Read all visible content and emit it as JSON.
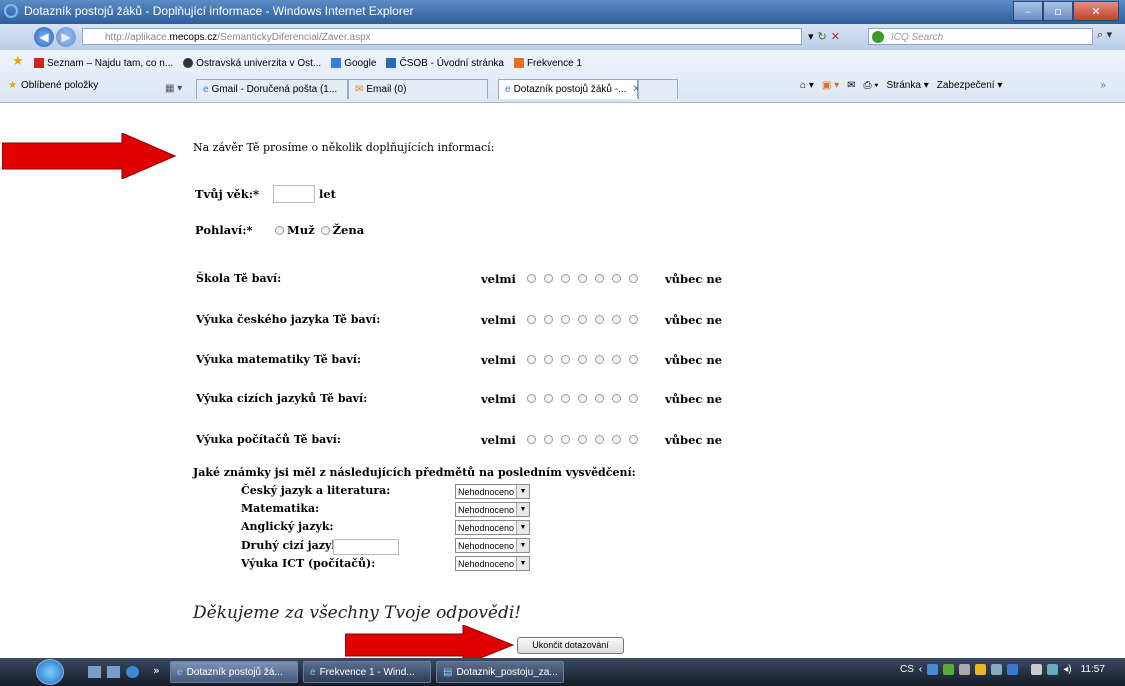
{
  "window": {
    "title": "Dotazník postojů žáků - Doplňující informace - Windows Internet Explorer",
    "minimize": "–",
    "maximize": "▫",
    "close": "✕"
  },
  "address": {
    "url_prefix": "http://aplikace.",
    "url_domain": "mecops.cz",
    "url_path": "/SemantickyDiferencial/Zaver.aspx",
    "search_placeholder": "ICQ Search"
  },
  "favorites": {
    "items": [
      {
        "label": "Seznam – Najdu tam, co n...",
        "icon": "seznam-icon",
        "color": "#d92020"
      },
      {
        "label": "Ostravská univerzita v Ost...",
        "icon": "university-icon",
        "color": "#333333"
      },
      {
        "label": "Google",
        "icon": "google-icon",
        "color": "#3a7be0"
      },
      {
        "label": "ČSOB - Úvodní stránka",
        "icon": "bank-icon",
        "color": "#2b6cb0"
      },
      {
        "label": "Frekvence 1",
        "icon": "radio-icon",
        "color": "#e8701a"
      }
    ],
    "favorites_label": "Oblíbené položky"
  },
  "tabs": [
    {
      "label": "Gmail - Doručená pošta (1..."
    },
    {
      "label": "Email (0)"
    },
    {
      "label": "Dotazník postojů žáků -...",
      "active": true
    }
  ],
  "commands": {
    "page": "Stránka ▾",
    "safety": "Zabezpečení ▾",
    "more": "»"
  },
  "form": {
    "intro": "Na závěr Tě prosíme o několik doplňujících informací:",
    "age_label": "Tvůj věk:*",
    "age_value": "",
    "age_unit": "let",
    "gender_label": "Pohlaví:*",
    "gender_male": "Muž",
    "gender_female": "Žena",
    "scale_left": "velmi",
    "scale_right": "vůbec ne",
    "scale_points": 7,
    "scale_items": [
      {
        "label": "Škola Tě baví:"
      },
      {
        "label": "Výuka českého jazyka Tě baví:"
      },
      {
        "label": "Výuka matematiky Tě baví:"
      },
      {
        "label": "Výuka cizích jazyků Tě baví:"
      },
      {
        "label": "Výuka počítačů Tě baví:"
      }
    ],
    "grades_question": "Jaké známky jsi měl z následujících předmětů na posledním vysvědčení:",
    "subjects": [
      {
        "label": "Český jazyk a literatura:",
        "value": "Nehodnoceno"
      },
      {
        "label": "Matematika:",
        "value": "Nehodnoceno"
      },
      {
        "label": "Anglický jazyk:",
        "value": "Nehodnoceno"
      },
      {
        "label": "Druhý cizí jazyk:",
        "value": "Nehodnoceno"
      },
      {
        "label": "Výuka ICT (počítačů):",
        "value": "Nehodnoceno"
      }
    ],
    "thanks": "Děkujeme za všechny Tvoje odpovědi!",
    "submit": "Ukončit dotazování"
  },
  "taskbar": {
    "buttons": [
      {
        "label": "Dotazník postojů žá...",
        "active": true
      },
      {
        "label": "Frekvence 1 - Wind..."
      },
      {
        "label": "Dotaznik_postoju_za..."
      }
    ],
    "language": "CS",
    "time": "11:57"
  },
  "colors": {
    "arrow": "#e00000",
    "titlebar": "#2d5d9c"
  }
}
